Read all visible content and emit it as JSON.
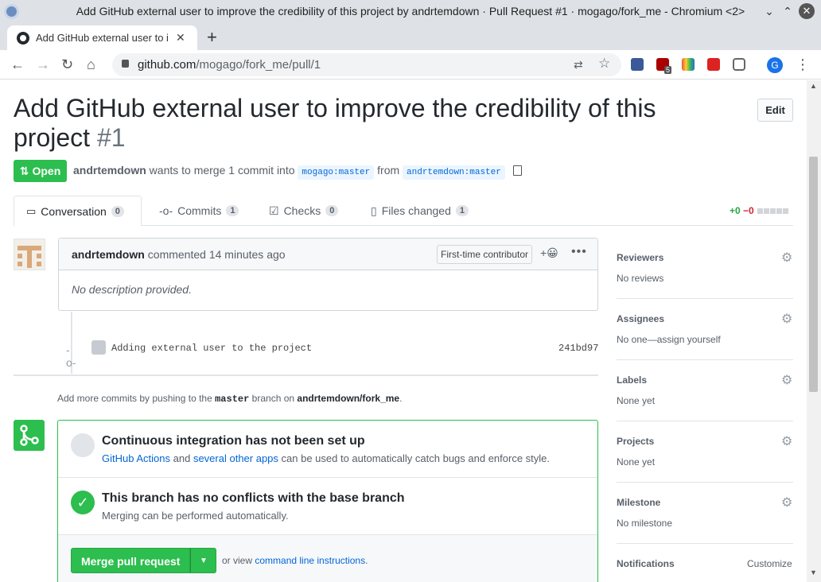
{
  "window": {
    "title": "Add GitHub external user to improve the credibility of this project by andrtemdown · Pull Request #1 · mogago/fork_me - Chromium <2>"
  },
  "browser": {
    "tab_title": "Add GitHub external user to i",
    "url_host": "github.com",
    "url_path": "/mogago/fork_me/pull/1",
    "avatar_letter": "G",
    "ext_badge": "5"
  },
  "pr": {
    "title": "Add GitHub external user to improve the credibility of this project",
    "number": "#1",
    "edit_label": "Edit",
    "state": "Open",
    "author": "andrtemdown",
    "meta_text": "wants to merge 1 commit into",
    "base_branch": "mogago:master",
    "from_text": "from",
    "head_branch": "andrtemdown:master"
  },
  "tabs": [
    {
      "label": "Conversation",
      "count": "0"
    },
    {
      "label": "Commits",
      "count": "1"
    },
    {
      "label": "Checks",
      "count": "0"
    },
    {
      "label": "Files changed",
      "count": "1"
    }
  ],
  "diffstat": {
    "additions": "+0",
    "deletions": "−0"
  },
  "comment": {
    "author": "andrtemdown",
    "action": "commented",
    "time": "14 minutes ago",
    "badge": "First-time contributor",
    "react": "+😀",
    "body": "No description provided."
  },
  "commit": {
    "message": "Adding external user to the project",
    "sha": "241bd97"
  },
  "add_more": {
    "prefix": "Add more commits by pushing to the",
    "branch": "master",
    "middle": "branch on",
    "repo": "andrtemdown/fork_me",
    "suffix": "."
  },
  "merge": {
    "ci_title": "Continuous integration has not been set up",
    "ci_link1": "GitHub Actions",
    "ci_and": "and",
    "ci_link2": "several other apps",
    "ci_rest": "can be used to automatically catch bugs and enforce style.",
    "conflict_title": "This branch has no conflicts with the base branch",
    "conflict_sub": "Merging can be performed automatically.",
    "button": "Merge pull request",
    "or_view": "or view",
    "cli_link": "command line instructions",
    "cli_suffix": "."
  },
  "sidebar": {
    "reviewers": {
      "label": "Reviewers",
      "value": "No reviews"
    },
    "assignees": {
      "label": "Assignees",
      "value": "No one—assign yourself"
    },
    "labels": {
      "label": "Labels",
      "value": "None yet"
    },
    "projects": {
      "label": "Projects",
      "value": "None yet"
    },
    "milestone": {
      "label": "Milestone",
      "value": "No milestone"
    },
    "notifications": {
      "label": "Notifications",
      "action": "Customize"
    }
  },
  "colors": {
    "green": "#2cbe4e",
    "link": "#0366d6",
    "text": "#24292e",
    "muted": "#586069"
  }
}
